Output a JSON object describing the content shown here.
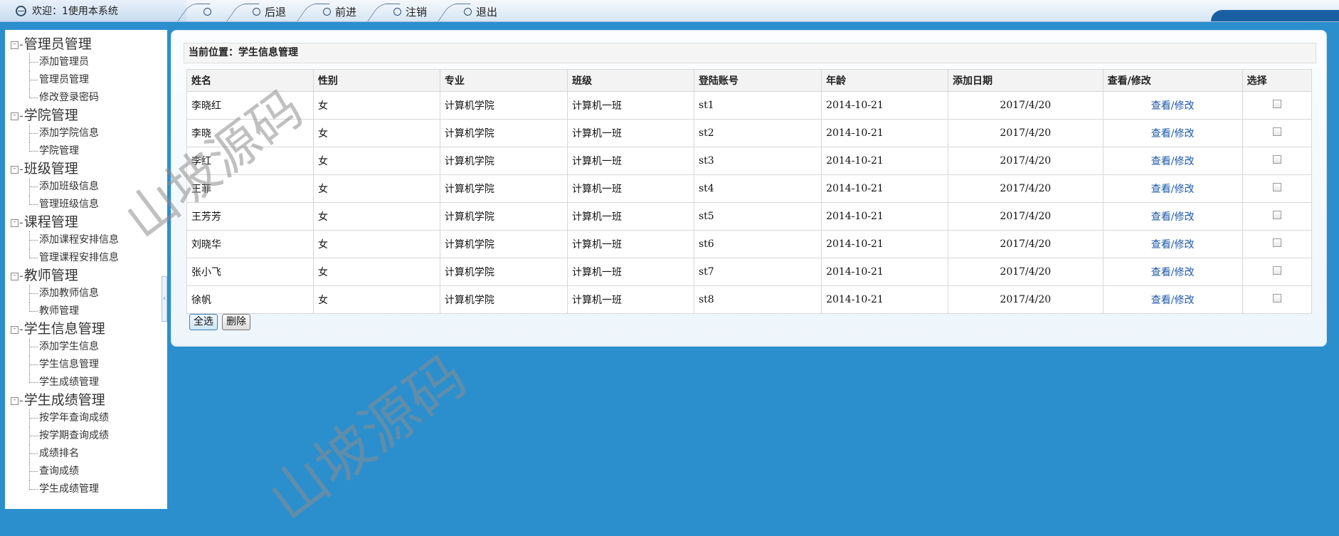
{
  "topbar": {
    "welcome": "欢迎：1使用本系统",
    "nav": [
      "",
      "后退",
      "前进",
      "注销",
      "退出"
    ]
  },
  "sidebar": {
    "groups": [
      {
        "title": "管理员管理",
        "items": [
          "添加管理员",
          "管理员管理",
          "修改登录密码"
        ]
      },
      {
        "title": "学院管理",
        "items": [
          "添加学院信息",
          "学院管理"
        ]
      },
      {
        "title": "班级管理",
        "items": [
          "添加班级信息",
          "管理班级信息"
        ]
      },
      {
        "title": "课程管理",
        "items": [
          "添加课程安排信息",
          "管理课程安排信息"
        ]
      },
      {
        "title": "教师管理",
        "items": [
          "添加教师信息",
          "教师管理"
        ]
      },
      {
        "title": "学生信息管理",
        "items": [
          "添加学生信息",
          "学生信息管理",
          "学生成绩管理"
        ]
      },
      {
        "title": "学生成绩管理",
        "items": [
          "按学年查询成绩",
          "按学期查询成绩",
          "成绩排名",
          "查询成绩",
          "学生成绩管理"
        ]
      }
    ]
  },
  "main": {
    "location": "当前位置：学生信息管理",
    "columns": [
      "姓名",
      "性别",
      "专业",
      "班级",
      "登陆账号",
      "年龄",
      "添加日期",
      "查看/修改",
      "选择"
    ],
    "rows": [
      {
        "name": "李晓红",
        "gender": "女",
        "major": "计算机学院",
        "class": "计算机一班",
        "account": "st1",
        "age": "2014-10-21",
        "date": "2017/4/20",
        "action": "查看/修改"
      },
      {
        "name": "李晓",
        "gender": "女",
        "major": "计算机学院",
        "class": "计算机一班",
        "account": "st2",
        "age": "2014-10-21",
        "date": "2017/4/20",
        "action": "查看/修改"
      },
      {
        "name": "李红",
        "gender": "女",
        "major": "计算机学院",
        "class": "计算机一班",
        "account": "st3",
        "age": "2014-10-21",
        "date": "2017/4/20",
        "action": "查看/修改"
      },
      {
        "name": "王菲",
        "gender": "女",
        "major": "计算机学院",
        "class": "计算机一班",
        "account": "st4",
        "age": "2014-10-21",
        "date": "2017/4/20",
        "action": "查看/修改"
      },
      {
        "name": "王芳芳",
        "gender": "女",
        "major": "计算机学院",
        "class": "计算机一班",
        "account": "st5",
        "age": "2014-10-21",
        "date": "2017/4/20",
        "action": "查看/修改"
      },
      {
        "name": "刘晓华",
        "gender": "女",
        "major": "计算机学院",
        "class": "计算机一班",
        "account": "st6",
        "age": "2014-10-21",
        "date": "2017/4/20",
        "action": "查看/修改"
      },
      {
        "name": "张小飞",
        "gender": "女",
        "major": "计算机学院",
        "class": "计算机一班",
        "account": "st7",
        "age": "2014-10-21",
        "date": "2017/4/20",
        "action": "查看/修改"
      },
      {
        "name": "徐帆",
        "gender": "女",
        "major": "计算机学院",
        "class": "计算机一班",
        "account": "st8",
        "age": "2014-10-21",
        "date": "2017/4/20",
        "action": "查看/修改"
      }
    ],
    "buttons": {
      "select_all": "全选",
      "delete": "删除"
    }
  },
  "watermark": "山坡源码",
  "colors": {
    "background": "#2b8fce",
    "link": "#1a57a8",
    "topbar_accent": "#1b5fa3"
  }
}
